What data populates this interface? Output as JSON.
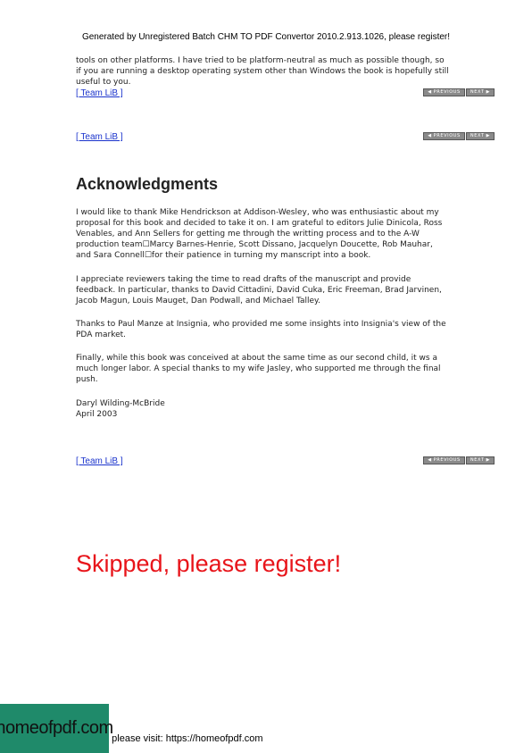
{
  "header": {
    "text": "Generated by Unregistered Batch CHM TO PDF Convertor 2010.2.913.1026,  please register!"
  },
  "top_paragraph": {
    "lines": [
      "tools on other platforms.  I have tried to be platform-neutral  as much as possible though,  so",
      "if you are running  a desktop operating system other than Windows the book  is hopefully  still",
      "useful to you."
    ]
  },
  "team_link": "[ Team LiB ]",
  "nav": {
    "previous": "PREVIOUS",
    "next": "NEXT",
    "prev_arrow": "◀",
    "next_arrow": "▶"
  },
  "section": {
    "heading": "Acknowledgments",
    "paragraphs": [
      [
        "I would  like  to thank Mike Hendrickson  at Addison-Wesley, who was enthusiastic about my",
        "proposal for this book and decided to take it on. I am grateful to editors Julie Dinicola,  Ross",
        "Venables,  and Ann Sellers for getting me through  the writting process and to the A-W",
        "production team☐Marcy  Barnes-Henrie,  Scott Dissano,  Jacquelyn Doucette, Rob Mauhar,",
        "and Sara Connell☐for  their patience in turning  my manscript  into a book."
      ],
      [
        "I appreciate reviewers taking  the time  to read drafts of the manuscript  and provide",
        "feedback. In particular,  thanks to David  Cittadini,  David  Cuka, Eric Freeman, Brad Jarvinen,",
        "Jacob Magun, Louis Mauget, Dan Podwall, and Michael Talley."
      ],
      [
        "Thanks to Paul Manze at Insignia, who provided me some insights into Insignia's  view of the",
        "PDA market."
      ],
      [
        "Finally,  while this book was conceived at about the same  time  as our second child, it ws a",
        "much longer labor.  A special thanks to my  wife Jasley, who supported me through  the final",
        "push."
      ],
      [
        "Daryl  Wilding-McBride",
        "April  2003"
      ]
    ]
  },
  "skipped": "Skipped, please register!",
  "badge": "homeofpdf.com",
  "footer": "e please visit: https://homeofpdf.com"
}
